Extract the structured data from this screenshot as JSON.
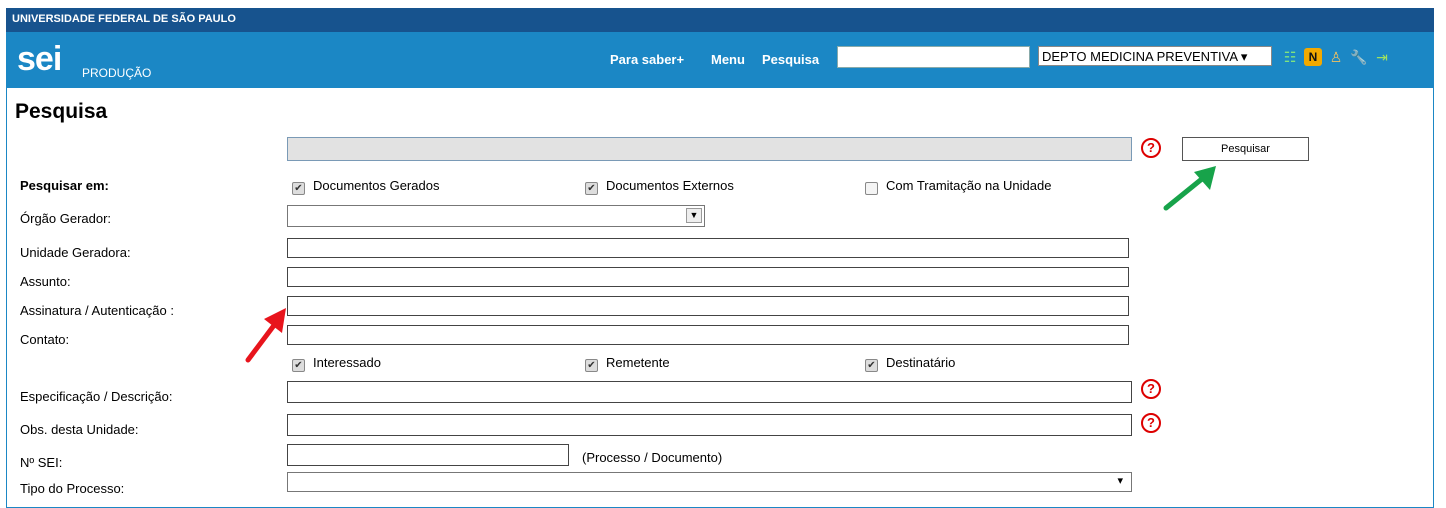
{
  "topbar": {
    "institution": "UNIVERSIDADE FEDERAL DE SÃO PAULO"
  },
  "header": {
    "logo": "sei",
    "environment": "PRODUÇÃO",
    "links": [
      "Para saber+",
      "Menu",
      "Pesquisa"
    ],
    "search_value": "",
    "unit_select": "DEPTO MEDICINA PREVENTIVA ▾",
    "icons": [
      "list-icon",
      "n-badge-icon",
      "user-icon",
      "wrench-icon",
      "exit-icon"
    ]
  },
  "page": {
    "title": "Pesquisa"
  },
  "search": {
    "button_label": "Pesquisar",
    "help": "?"
  },
  "form": {
    "pesquisar_em_label": "Pesquisar em:",
    "pesquisar_em": [
      {
        "label": "Documentos Gerados",
        "checked": true
      },
      {
        "label": "Documentos Externos",
        "checked": true
      },
      {
        "label": "Com Tramitação na Unidade",
        "checked": false
      }
    ],
    "orgao_label": "Órgão Gerador:",
    "unidade_label": "Unidade Geradora:",
    "assunto_label": "Assunto:",
    "assinatura_label": "Assinatura / Autenticação :",
    "contato_label": "Contato:",
    "contato_options": [
      {
        "label": "Interessado",
        "checked": true
      },
      {
        "label": "Remetente",
        "checked": true
      },
      {
        "label": "Destinatário",
        "checked": true
      }
    ],
    "especificacao_label": "Especificação / Descrição:",
    "obs_label": "Obs. desta Unidade:",
    "numero_sei_label": "Nº SEI:",
    "numero_sei_note": "(Processo / Documento)",
    "tipo_processo_label": "Tipo do Processo:",
    "tipo_processo_arrow": "▾"
  },
  "colors": {
    "topbar": "#17538e",
    "header": "#1b87c5",
    "arrow_red": "#e8141c",
    "arrow_green": "#17a34a"
  }
}
